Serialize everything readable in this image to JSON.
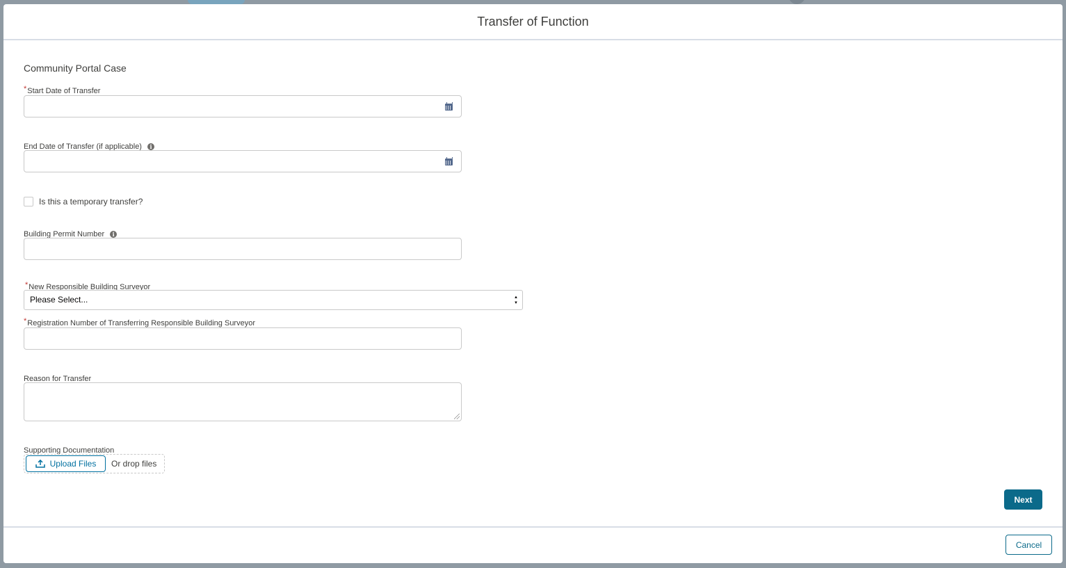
{
  "modal": {
    "title": "Transfer of Function"
  },
  "form": {
    "section_title": "Community Portal Case",
    "start_date": {
      "label": "Start Date of Transfer",
      "required": true,
      "value": ""
    },
    "end_date": {
      "label": "End Date of Transfer (if applicable)",
      "required": false,
      "value": ""
    },
    "temporary": {
      "label": "Is this a temporary transfer?",
      "checked": false
    },
    "permit_number": {
      "label": "Building Permit Number",
      "value": ""
    },
    "new_surveyor": {
      "label": "New Responsible Building Surveyor",
      "required": true,
      "selected": "Please Select..."
    },
    "registration_number": {
      "label": "Registration Number of Transferring Responsible Building Surveyor",
      "required": true,
      "value": ""
    },
    "reason": {
      "label": "Reason for Transfer",
      "value": ""
    },
    "documentation": {
      "label": "Supporting Documentation",
      "upload_label": "Upload Files",
      "drop_text": "Or drop files"
    },
    "next_label": "Next"
  },
  "footer": {
    "cancel_label": "Cancel"
  },
  "colors": {
    "brand": "#0b6a8a",
    "required": "#c23934",
    "border": "#c9c9c9"
  }
}
